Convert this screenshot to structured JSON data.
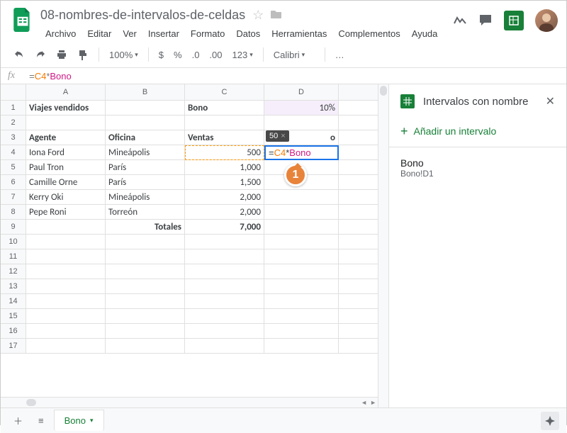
{
  "doc_title": "08-nombres-de-intervalos-de-celdas",
  "menu": [
    "Archivo",
    "Editar",
    "Ver",
    "Insertar",
    "Formato",
    "Datos",
    "Herramientas",
    "Complementos",
    "Ayuda"
  ],
  "toolbar": {
    "zoom": "100%",
    "font": "Calibri",
    "more": "…",
    "num_fmts": [
      "$",
      "%",
      ".0",
      ".00",
      "123"
    ]
  },
  "formula_bar": {
    "prefix": "=",
    "ref1": "C4",
    "op": "*",
    "ref2": "Bono"
  },
  "columns": [
    "A",
    "B",
    "C",
    "D"
  ],
  "rows": {
    "r1": {
      "a": "Viajes vendidos",
      "c": "Bono",
      "d": "10%"
    },
    "r3": {
      "a": "Agente",
      "b": "Oficina",
      "c": "Ventas",
      "d_partial": "o"
    },
    "data": [
      {
        "n": "4",
        "a": "Iona Ford",
        "b": "Mineápolis",
        "c": "500"
      },
      {
        "n": "5",
        "a": "Paul Tron",
        "b": "París",
        "c": "1,000"
      },
      {
        "n": "6",
        "a": "Camille Orne",
        "b": "París",
        "c": "1,500"
      },
      {
        "n": "7",
        "a": "Kerry Oki",
        "b": "Mineápolis",
        "c": "2,000"
      },
      {
        "n": "8",
        "a": "Pepe Roni",
        "b": "Torreón",
        "c": "2,000"
      }
    ],
    "totals": {
      "n": "9",
      "label": "Totales",
      "value": "7,000"
    },
    "blank_start": 10,
    "blank_end": 17
  },
  "edit_overlay": {
    "tooltip_value": "50",
    "prefix": "=",
    "ref1": "C4",
    "op": "*",
    "ref2": "Bono"
  },
  "callout": "1",
  "side": {
    "title": "Intervalos con nombre",
    "add": "Añadir un intervalo",
    "items": [
      {
        "name": "Bono",
        "ref": "Bono!D1"
      }
    ]
  },
  "sheet_tab": "Bono"
}
